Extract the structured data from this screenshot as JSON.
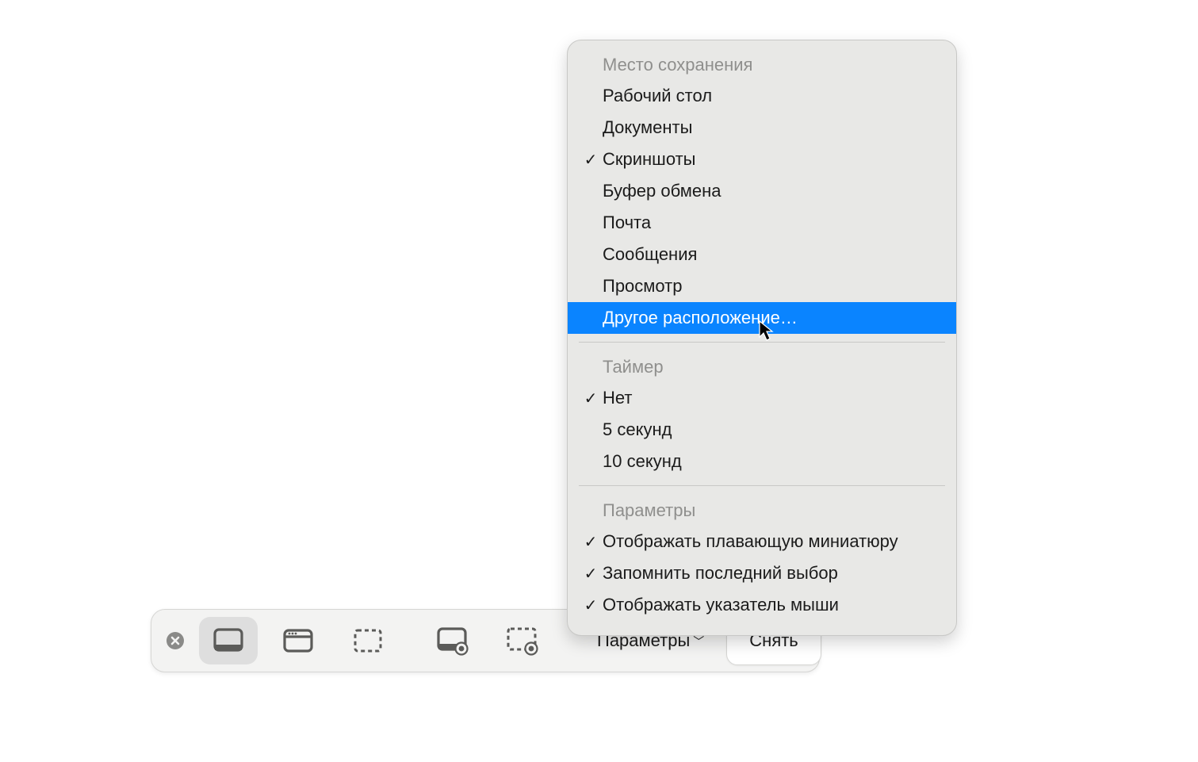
{
  "toolbar": {
    "options_label": "Параметры",
    "capture_label": "Снять"
  },
  "menu": {
    "sections": [
      {
        "title": "Место сохранения",
        "items": [
          {
            "label": "Рабочий стол",
            "checked": false,
            "highlighted": false
          },
          {
            "label": "Документы",
            "checked": false,
            "highlighted": false
          },
          {
            "label": "Скриншоты",
            "checked": true,
            "highlighted": false
          },
          {
            "label": "Буфер обмена",
            "checked": false,
            "highlighted": false
          },
          {
            "label": "Почта",
            "checked": false,
            "highlighted": false
          },
          {
            "label": "Сообщения",
            "checked": false,
            "highlighted": false
          },
          {
            "label": "Просмотр",
            "checked": false,
            "highlighted": false
          },
          {
            "label": "Другое расположение…",
            "checked": false,
            "highlighted": true
          }
        ]
      },
      {
        "title": "Таймер",
        "items": [
          {
            "label": "Нет",
            "checked": true,
            "highlighted": false
          },
          {
            "label": "5 секунд",
            "checked": false,
            "highlighted": false
          },
          {
            "label": "10 секунд",
            "checked": false,
            "highlighted": false
          }
        ]
      },
      {
        "title": "Параметры",
        "items": [
          {
            "label": "Отображать плавающую миниатюру",
            "checked": true,
            "highlighted": false
          },
          {
            "label": "Запомнить последний выбор",
            "checked": true,
            "highlighted": false
          },
          {
            "label": "Отображать указатель мыши",
            "checked": true,
            "highlighted": false
          }
        ]
      }
    ]
  }
}
